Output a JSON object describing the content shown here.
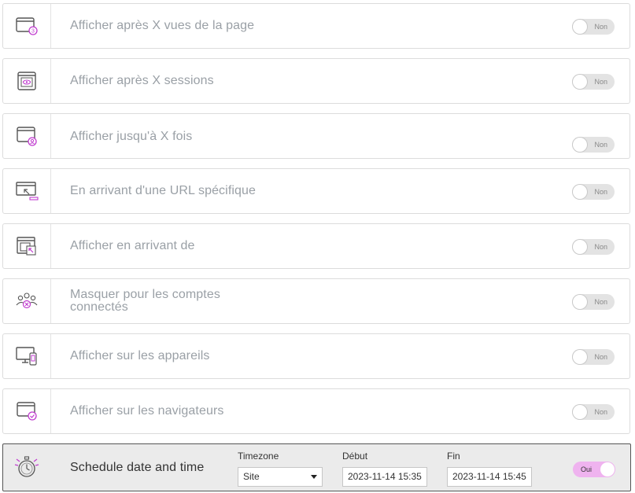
{
  "rules": [
    {
      "label": "Afficher après X vues de la page",
      "toggle": "Non",
      "icon": "page-views-icon"
    },
    {
      "label": "Afficher après X sessions",
      "toggle": "Non",
      "icon": "sessions-eye-icon"
    },
    {
      "label": "Afficher jusqu'à X fois",
      "toggle": "Non",
      "icon": "max-times-icon"
    },
    {
      "label": "En arrivant d'une URL spécifique",
      "toggle": "Non",
      "icon": "specific-url-icon"
    },
    {
      "label": "Afficher en arrivant de",
      "toggle": "Non",
      "icon": "arriving-from-icon"
    },
    {
      "label_line1": "Masquer pour les comptes",
      "label_line2": "connectés",
      "toggle": "Non",
      "icon": "connected-accounts-icon"
    },
    {
      "label": "Afficher sur les appareils",
      "toggle": "Non",
      "icon": "devices-icon"
    },
    {
      "label": "Afficher sur les navigateurs",
      "toggle": "Non",
      "icon": "browsers-icon"
    }
  ],
  "schedule": {
    "label": "Schedule date and time",
    "icon": "stopwatch-icon",
    "timezone_label": "Timezone",
    "timezone_value": "Site",
    "start_label": "Début",
    "start_value": "2023-11-14 15:35",
    "end_label": "Fin",
    "end_value": "2023-11-14 15:45",
    "toggle": "Oui"
  },
  "colors": {
    "accent": "#e040fb",
    "toggle_on": "#efb3ef",
    "toggle_off": "#e3e3e3",
    "label_muted": "#9aa0a6"
  }
}
